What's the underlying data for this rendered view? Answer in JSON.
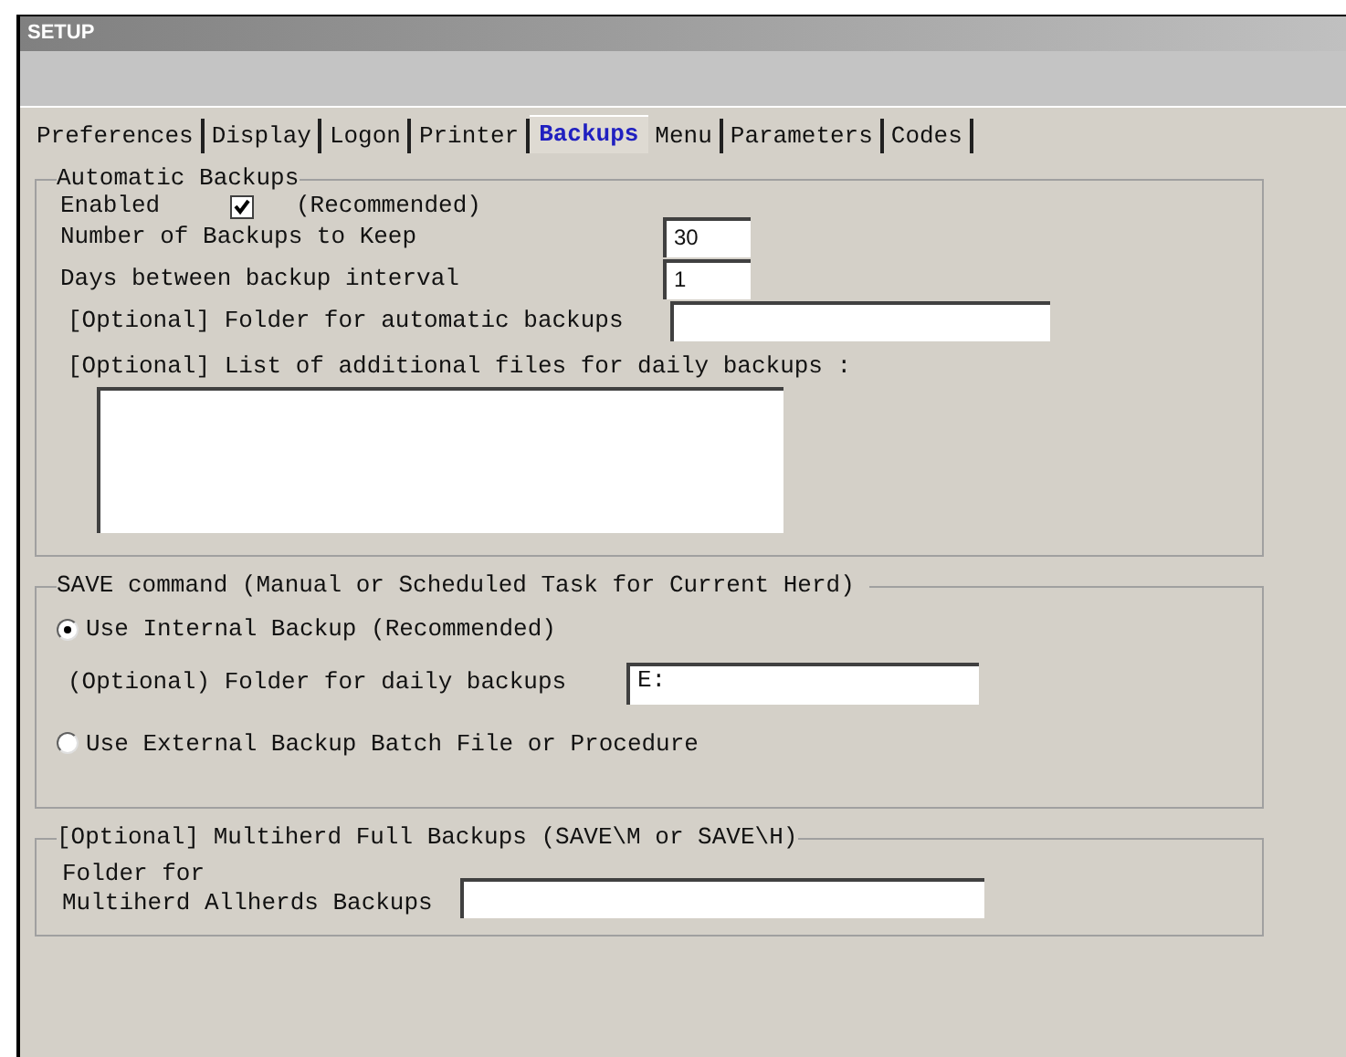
{
  "window": {
    "title": "SETUP"
  },
  "tabs": [
    {
      "label": "Preferences",
      "selected": false
    },
    {
      "label": "Display",
      "selected": false
    },
    {
      "label": "Logon",
      "selected": false
    },
    {
      "label": "Printer",
      "selected": false
    },
    {
      "label": "Backups",
      "selected": true
    },
    {
      "label": "Menu",
      "selected": false
    },
    {
      "label": "Parameters",
      "selected": false
    },
    {
      "label": "Codes",
      "selected": false
    }
  ],
  "automatic_backups": {
    "title": "Automatic Backups",
    "enabled": {
      "label": "Enabled",
      "checked": true,
      "note": "(Recommended)"
    },
    "fields": [
      {
        "label": "Number of Backups to Keep",
        "value": "30"
      },
      {
        "label": "Days between backup interval",
        "value": "1"
      },
      {
        "label": "[Optional] Folder for automatic backups"
      }
    ],
    "files_list": {
      "label": "[Optional] List of additional files for daily backups :"
    }
  },
  "save_command": {
    "title": "SAVE command (Manual or Scheduled Task for Current Herd)",
    "options": [
      {
        "label": "Use Internal Backup (Recommended)",
        "selected": true
      },
      {
        "label": "Use External Backup Batch File or Procedure",
        "selected": false
      }
    ],
    "daily_folder": {
      "label": "(Optional) Folder for daily backups",
      "value": "E:"
    }
  },
  "multiherd": {
    "title": "[Optional] Multiherd Full Backups (SAVE\\M or SAVE\\H)",
    "folder": {
      "label_lines": [
        "Folder for",
        "Multiherd Allherds Backups"
      ]
    }
  }
}
